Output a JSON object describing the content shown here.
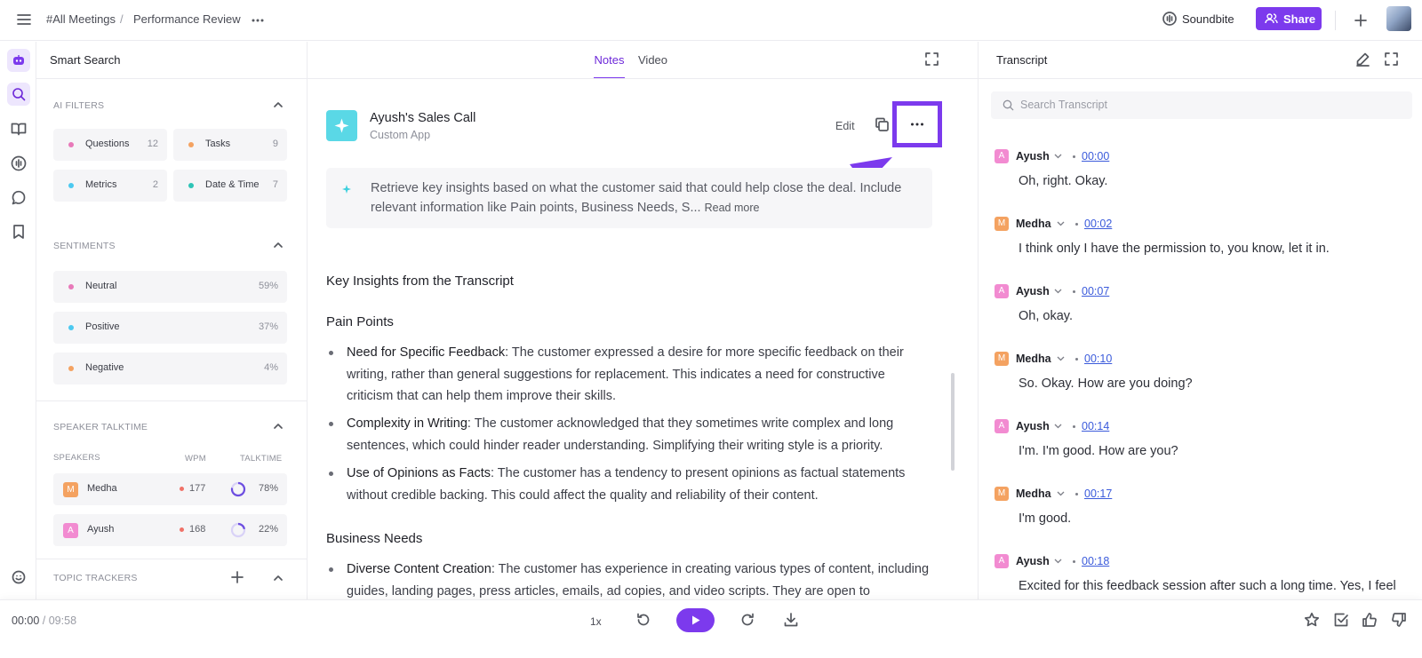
{
  "breadcrumb": {
    "root": "#All Meetings",
    "sep": "/",
    "current": "Performance Review"
  },
  "topbar": {
    "soundbite_label": "Soundbite",
    "share_label": "Share",
    "accent": "#7c3aed"
  },
  "sidebar": {
    "title": "Smart Search",
    "ai_filters": {
      "heading": "AI FILTERS",
      "items": [
        {
          "label": "Questions",
          "count": "12",
          "color": "#e879b9"
        },
        {
          "label": "Tasks",
          "count": "9",
          "color": "#f4a261"
        },
        {
          "label": "Metrics",
          "count": "2",
          "color": "#4cc9f0"
        },
        {
          "label": "Date & Time",
          "count": "7",
          "color": "#2ec4b6"
        }
      ]
    },
    "sentiments": {
      "heading": "SENTIMENTS",
      "items": [
        {
          "label": "Neutral",
          "value": "59%",
          "color": "#e879b9"
        },
        {
          "label": "Positive",
          "value": "37%",
          "color": "#4cc9f0"
        },
        {
          "label": "Negative",
          "value": "4%",
          "color": "#f4a261"
        }
      ]
    },
    "speaker_talktime": {
      "heading": "SPEAKER TALKTIME",
      "col_speakers": "SPEAKERS",
      "col_wpm": "WPM",
      "col_talktime": "TALKTIME",
      "speakers": [
        {
          "initial": "M",
          "name": "Medha",
          "wpm": "177",
          "talktime": "78%",
          "share": 0.78,
          "color": "#f4a261"
        },
        {
          "initial": "A",
          "name": "Ayush",
          "wpm": "168",
          "talktime": "22%",
          "share": 0.22,
          "color": "#f28bd1"
        }
      ]
    },
    "topic_trackers": {
      "heading": "TOPIC TRACKERS"
    }
  },
  "center": {
    "tabs": [
      {
        "label": "Notes",
        "active": true
      },
      {
        "label": "Video",
        "active": false
      }
    ],
    "app": {
      "title": "Ayush's Sales Call",
      "subtitle": "Custom App",
      "edit_label": "Edit"
    },
    "prompt": {
      "line1": "Retrieve key insights based on what the customer said that could help close the deal. Include",
      "line2": "relevant information like Pain points, Business Needs, S...",
      "read_more": "Read more"
    },
    "heading": "Key Insights from the Transcript",
    "pain_points": {
      "heading": "Pain Points",
      "items": [
        {
          "title": "Need for Specific Feedback",
          "text": ": The customer expressed a desire for more specific feedback on their writing, rather than general suggestions for replacement. This indicates a need for constructive criticism that can help them improve their skills."
        },
        {
          "title": "Complexity in Writing",
          "text": ": The customer acknowledged that they sometimes write complex and long sentences, which could hinder reader understanding. Simplifying their writing style is a priority."
        },
        {
          "title": "Use of Opinions as Facts",
          "text": ": The customer has a tendency to present opinions as factual statements without credible backing. This could affect the quality and reliability of their content."
        }
      ]
    },
    "business_needs": {
      "heading": "Business Needs",
      "items": [
        {
          "title": "Diverse Content Creation",
          "text": ": The customer has experience in creating various types of content, including guides, landing pages, press articles, emails, ad copies, and video scripts. They are open to"
        }
      ]
    }
  },
  "transcript": {
    "title": "Transcript",
    "search_placeholder": "Search Transcript",
    "entries": [
      {
        "initial": "A",
        "speaker": "Ayush",
        "time": "00:00",
        "text": "Oh, right. Okay.",
        "color": "#f28bd1"
      },
      {
        "initial": "M",
        "speaker": "Medha",
        "time": "00:02",
        "text": "I think only I have the permission to, you know, let it in.",
        "color": "#f4a261"
      },
      {
        "initial": "A",
        "speaker": "Ayush",
        "time": "00:07",
        "text": "Oh, okay.",
        "color": "#f28bd1"
      },
      {
        "initial": "M",
        "speaker": "Medha",
        "time": "00:10",
        "text": "So. Okay. How are you doing?",
        "color": "#f4a261"
      },
      {
        "initial": "A",
        "speaker": "Ayush",
        "time": "00:14",
        "text": "I'm. I'm good. How are you?",
        "color": "#f28bd1"
      },
      {
        "initial": "M",
        "speaker": "Medha",
        "time": "00:17",
        "text": "I'm good.",
        "color": "#f4a261"
      },
      {
        "initial": "A",
        "speaker": "Ayush",
        "time": "00:18",
        "text": "Excited for this feedback session after such a long time. Yes, I feel",
        "color": "#f28bd1"
      }
    ]
  },
  "player": {
    "current": "00:00",
    "sep": "/",
    "duration": "09:58",
    "speed": "1x"
  }
}
